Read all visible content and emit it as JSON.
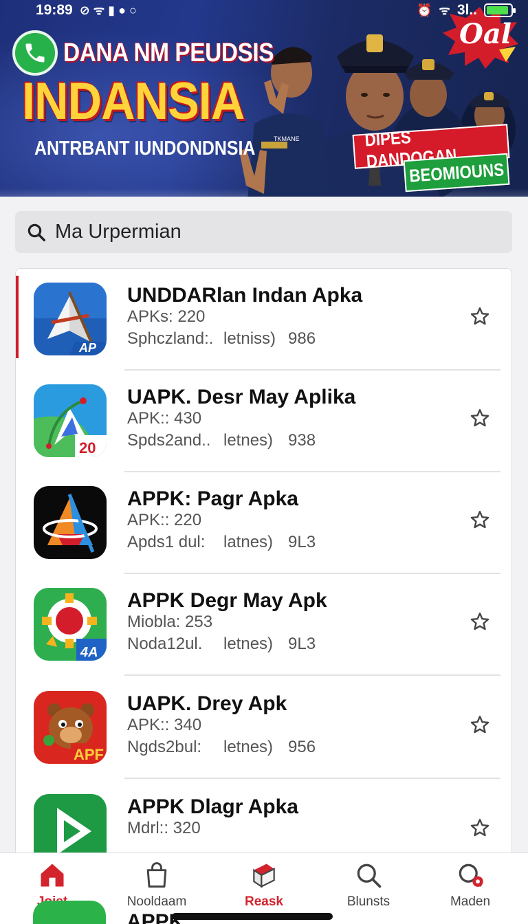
{
  "status_bar": {
    "time": "19:89",
    "network": "3l..",
    "battery_level": 0.9
  },
  "banner": {
    "title_line1": "DANA NM PEUDSIS",
    "title_line2": "INDANSIA",
    "subtitle": "ANTRBANT IUNDONDNSIA",
    "badge": "Oal",
    "tag_red": "DIPES DANDOGAN",
    "tag_green": "BEOMIOUNS",
    "officer_badge_text": "TKMANE"
  },
  "search": {
    "value": "Ma Urpermian"
  },
  "apps": [
    {
      "name": "UNDDARlan Indan Apka",
      "meta": "APKs: 220",
      "stat1": "Sphczland:.",
      "stat2": "letniss)",
      "stat3": "986",
      "icon_badge": "AP"
    },
    {
      "name": "UAPK. Desr May Aplika",
      "meta": "APK:: 430",
      "stat1": "Spds2and..",
      "stat2": "letnes)",
      "stat3": "938",
      "icon_badge": "20"
    },
    {
      "name": "APPK: Pagr Apka",
      "meta": "APK:: 220",
      "stat1": "Apds1 dul:",
      "stat2": "latnes)",
      "stat3": "9L3",
      "icon_badge": ""
    },
    {
      "name": "APPK Degr May Apk",
      "meta": "Miobla: 253",
      "stat1": "Noda12ul.",
      "stat2": "letnes)",
      "stat3": "9L3",
      "icon_badge": "4A"
    },
    {
      "name": "UAPK. Drey Apk",
      "meta": "APK:: 340",
      "stat1": "Ngds2bul:",
      "stat2": "letnes)",
      "stat3": "956",
      "icon_badge": "APF"
    },
    {
      "name": "APPK Dlagr Apka",
      "meta": "Mdrl:: 320",
      "stat1": "",
      "stat2": "",
      "stat3": "",
      "icon_badge": ""
    }
  ],
  "peek_row": {
    "name": "APPK"
  },
  "bottom_nav": [
    {
      "label": "Jojet",
      "icon": "home-icon",
      "active": true
    },
    {
      "label": "Nooldaam",
      "icon": "bag-icon",
      "active": false
    },
    {
      "label": "Reask",
      "icon": "box-icon",
      "active": true
    },
    {
      "label": "Blunsts",
      "icon": "search-icon",
      "active": false
    },
    {
      "label": "Maden",
      "icon": "search-notification-icon",
      "active": false
    }
  ],
  "colors": {
    "accent_red": "#d3232d",
    "banner_blue": "#23388c",
    "title_yellow": "#ffd43a",
    "tag_green": "#1e9e3c"
  }
}
